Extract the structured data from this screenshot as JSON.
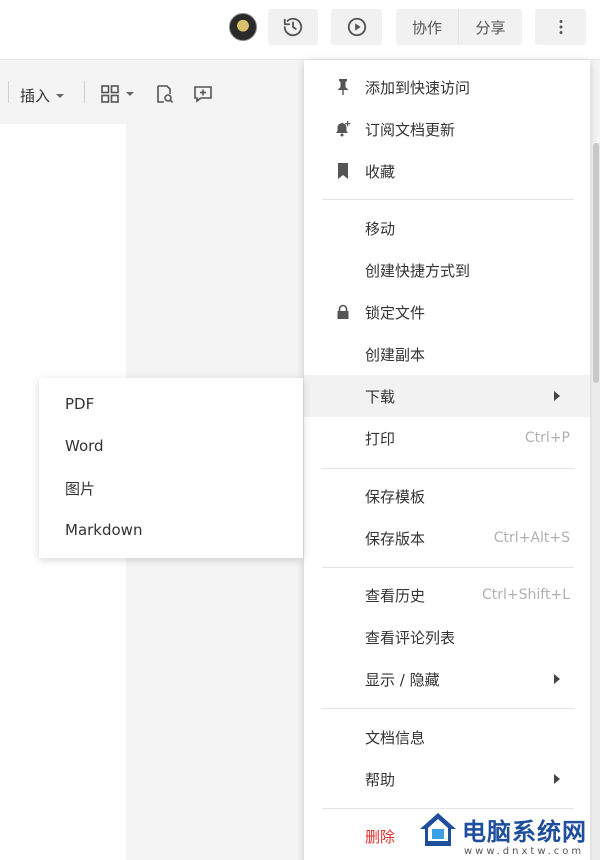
{
  "header": {
    "collab_label": "协作",
    "share_label": "分享",
    "icons": [
      "avatar",
      "history-icon",
      "play-icon",
      "more-vertical-icon"
    ]
  },
  "toolbar": {
    "insert_label": "插入",
    "icons": [
      "grid-icon",
      "search-doc-icon",
      "comment-add-icon"
    ]
  },
  "menu": {
    "items": [
      {
        "label": "添加到快速访问",
        "icon": "pin-icon"
      },
      {
        "label": "订阅文档更新",
        "icon": "bell-plus-icon"
      },
      {
        "label": "收藏",
        "icon": "bookmark-icon"
      },
      {
        "label": "移动"
      },
      {
        "label": "创建快捷方式到"
      },
      {
        "label": "锁定文件",
        "icon": "lock-icon"
      },
      {
        "label": "创建副本"
      },
      {
        "label": "下载",
        "has_submenu": true,
        "highlighted": true
      },
      {
        "label": "打印",
        "shortcut": "Ctrl+P"
      },
      {
        "label": "保存模板"
      },
      {
        "label": "保存版本",
        "shortcut": "Ctrl+Alt+S"
      },
      {
        "label": "查看历史",
        "shortcut": "Ctrl+Shift+L"
      },
      {
        "label": "查看评论列表"
      },
      {
        "label": "显示 / 隐藏",
        "has_submenu": true
      },
      {
        "label": "文档信息"
      },
      {
        "label": "帮助",
        "has_submenu": true
      },
      {
        "label": "删除",
        "danger": true
      }
    ]
  },
  "submenu": {
    "items": [
      {
        "label": "PDF"
      },
      {
        "label": "Word"
      },
      {
        "label": "图片"
      },
      {
        "label": "Markdown"
      }
    ]
  },
  "watermark": {
    "text": "电脑系统网",
    "url": "www.dnxtw.com"
  },
  "colors": {
    "danger": "#e0302a",
    "watermark_blue": "#1f4f9c",
    "menu_hover": "#f2f2f2",
    "shortcut_gray": "#b0b0b0"
  }
}
